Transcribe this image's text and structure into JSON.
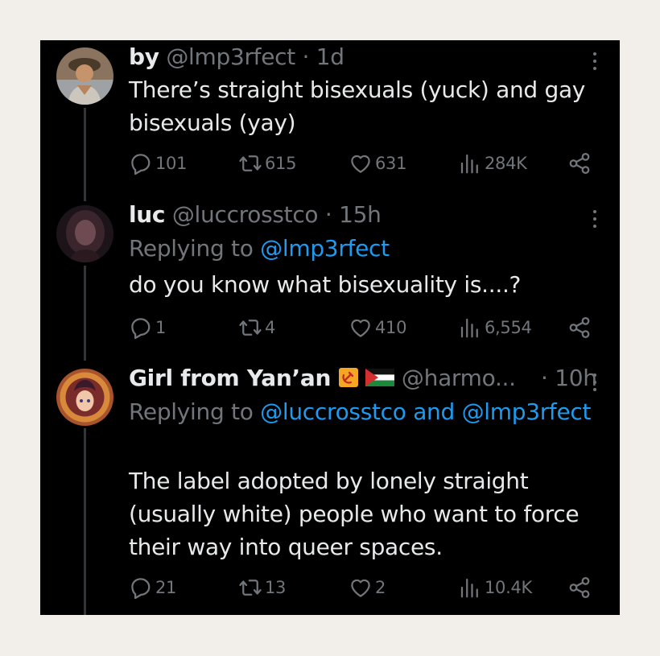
{
  "tweets": [
    {
      "name": "by",
      "handle": "@lmp3rfect",
      "separator": "·",
      "time": "1d",
      "text": "There’s straight bisexuals (yuck) and gay bisexuals (yay)",
      "replies": "101",
      "reposts": "615",
      "likes": "631",
      "views": "284K"
    },
    {
      "name": "luc",
      "handle": "@luccrosstco",
      "separator": "·",
      "time": "15h",
      "replying_prefix": "Replying to",
      "replying_to": "@lmp3rfect",
      "text": "do you know what bisexuality is....?",
      "replies": "1",
      "reposts": "4",
      "likes": "410",
      "views": "6,554"
    },
    {
      "name": "Girl from Yan’an",
      "handle": "@harmo...",
      "separator": "·",
      "time": "10h",
      "replying_prefix": "Replying to",
      "replying_to": "@luccrosstco and @lmp3rfect",
      "text": "The label adopted by lonely straight (usually white) people who want to force their way into queer spaces.",
      "replies": "21",
      "reposts": "13",
      "likes": "2",
      "views": "10.4K"
    }
  ],
  "colors": {
    "background": "#000000",
    "page": "#f2eeea",
    "text_primary": "#e7e9ea",
    "text_secondary": "#71767b",
    "link": "#1d9bf0"
  },
  "icons": [
    "reply-icon",
    "repost-icon",
    "like-icon",
    "views-icon",
    "share-icon",
    "more-icon",
    "hammer-sickle-emoji",
    "palestine-flag-emoji"
  ]
}
